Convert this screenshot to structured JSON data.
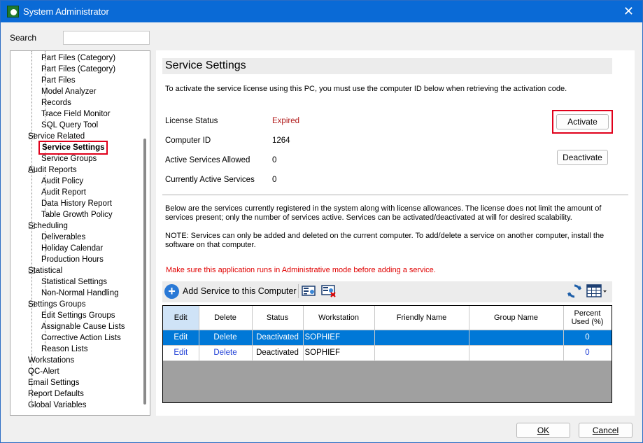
{
  "window": {
    "title": "System Administrator",
    "close_glyph": "✕"
  },
  "search": {
    "label": "Search",
    "value": ""
  },
  "tree": {
    "nodes": [
      {
        "label": "Part Files (Category)",
        "level": 2
      },
      {
        "label": "Part Files (Category)",
        "level": 2
      },
      {
        "label": "Part Files",
        "level": 2
      },
      {
        "label": "Model Analyzer",
        "level": 2
      },
      {
        "label": "Records",
        "level": 2
      },
      {
        "label": "Trace Field Monitor",
        "level": 2
      },
      {
        "label": "SQL Query Tool",
        "level": 2
      },
      {
        "label": "Service Related",
        "level": 1
      },
      {
        "label": "Service Settings",
        "level": 2,
        "selected": true
      },
      {
        "label": "Service Groups",
        "level": 2
      },
      {
        "label": "Audit Reports",
        "level": 1
      },
      {
        "label": "Audit Policy",
        "level": 2
      },
      {
        "label": "Audit Report",
        "level": 2
      },
      {
        "label": "Data History Report",
        "level": 2
      },
      {
        "label": "Table Growth Policy",
        "level": 2
      },
      {
        "label": "Scheduling",
        "level": 1
      },
      {
        "label": "Deliverables",
        "level": 2
      },
      {
        "label": "Holiday Calendar",
        "level": 2
      },
      {
        "label": "Production Hours",
        "level": 2
      },
      {
        "label": "Statistical",
        "level": 1
      },
      {
        "label": "Statistical Settings",
        "level": 2
      },
      {
        "label": "Non-Normal Handling",
        "level": 2
      },
      {
        "label": "Settings Groups",
        "level": 1
      },
      {
        "label": "Edit Settings Groups",
        "level": 2
      },
      {
        "label": "Assignable Cause Lists",
        "level": 2
      },
      {
        "label": "Corrective Action Lists",
        "level": 2
      },
      {
        "label": "Reason Lists",
        "level": 2
      },
      {
        "label": "Workstations",
        "level": 0
      },
      {
        "label": "QC-Alert",
        "level": 0
      },
      {
        "label": "Email Settings",
        "level": 0
      },
      {
        "label": "Report Defaults",
        "level": 0
      },
      {
        "label": "Global Variables",
        "level": 0
      }
    ]
  },
  "panel": {
    "title": "Service Settings",
    "intro": "To activate the service license using this PC, you must use the computer ID below when retrieving the activation code.",
    "license_status_label": "License Status",
    "license_status_value": "Expired",
    "computer_id_label": "Computer ID",
    "computer_id_value": "1264",
    "active_allowed_label": "Active Services Allowed",
    "active_allowed_value": "0",
    "currently_active_label": "Currently Active Services",
    "currently_active_value": "0",
    "activate_label": "Activate",
    "deactivate_label": "Deactivate",
    "desc1": "Below are the services currently registered in the system along with license allowances. The license does not limit the amount of services present; only the number of services active. Services can be activated/deactivated at will for desired scalability.",
    "desc2": "NOTE: Services can only be added and deleted on the current computer. To add/delete a service on another computer, install the software on that computer.",
    "warning": "Make sure this application runs in Administrative mode before adding a service.",
    "add_service_label": "Add Service to this Computer",
    "colors": {
      "expired": "#b11a1a",
      "warning": "#e00000",
      "selection": "#0078d7",
      "highlight_frame": "#e0001b"
    }
  },
  "grid": {
    "columns": [
      "Edit",
      "Delete",
      "Status",
      "Workstation",
      "Friendly Name",
      "Group Name",
      "Percent Used (%)"
    ],
    "rows": [
      {
        "edit": "Edit",
        "delete": "Delete",
        "status": "Deactivated",
        "workstation": "SOPHIEF",
        "friendly": "",
        "group": "",
        "percent": "0",
        "selected": true
      },
      {
        "edit": "Edit",
        "delete": "Delete",
        "status": "Deactivated",
        "workstation": "SOPHIEF",
        "friendly": "",
        "group": "",
        "percent": "0",
        "selected": false
      }
    ]
  },
  "footer": {
    "ok_label": "OK",
    "cancel_label": "Cancel"
  }
}
